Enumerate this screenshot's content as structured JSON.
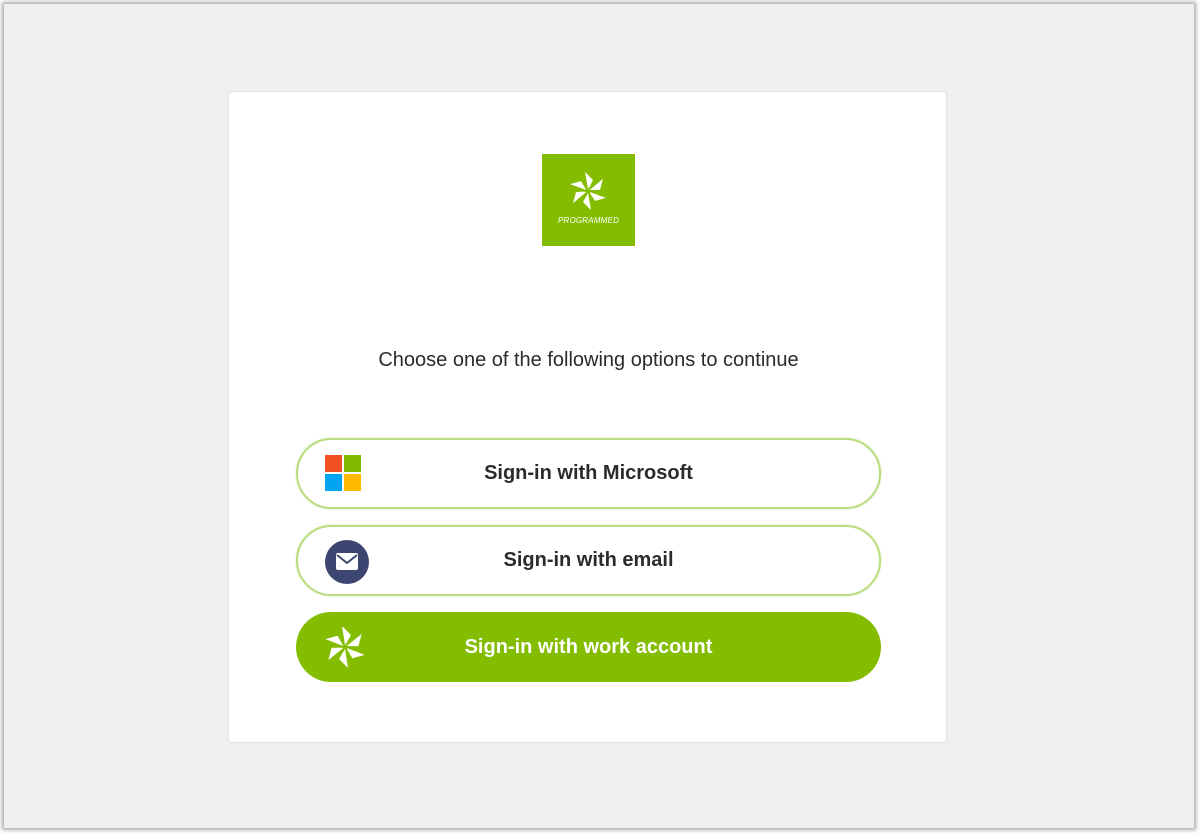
{
  "brand": {
    "logo_text": "PROGRAMMED",
    "accent_color": "#84bd00",
    "logo_icon": "pinwheel-icon"
  },
  "login": {
    "prompt": "Choose one of the following options to continue",
    "buttons": {
      "microsoft": {
        "label": "Sign-in with Microsoft",
        "icon": "microsoft-icon"
      },
      "email": {
        "label": "Sign-in with email",
        "icon": "mail-icon"
      },
      "work": {
        "label": "Sign-in with work account",
        "icon": "pinwheel-icon"
      }
    }
  },
  "colors": {
    "background": "#efefef",
    "card": "#ffffff",
    "button_border": "#b9dc7f",
    "mail_icon_bg": "#3d4670",
    "ms_red": "#f25022",
    "ms_green": "#7fba00",
    "ms_blue": "#00a4ef",
    "ms_yellow": "#ffb900"
  }
}
